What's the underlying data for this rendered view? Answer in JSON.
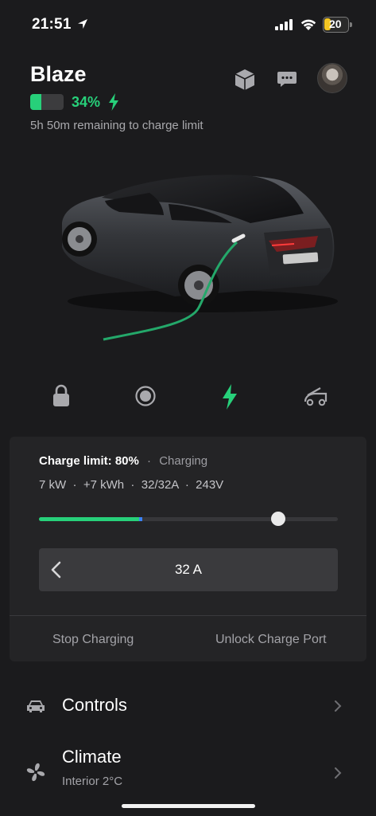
{
  "status_bar": {
    "time": "21:51",
    "battery_level": "20",
    "battery_color": "#f3c623"
  },
  "header": {
    "car_name": "Blaze",
    "battery_percent": "34%",
    "battery_fraction": 0.34,
    "remaining": "5h 50m remaining to charge limit",
    "accent": "#27d07a"
  },
  "quick_controls": [
    "lock-icon",
    "sentry-icon",
    "charge-bolt-icon",
    "frunk-icon"
  ],
  "charge_card": {
    "limit_label": "Charge limit: 80%",
    "separator": "·",
    "state": "Charging",
    "stats": "7 kW  ·  +7 kWh  ·  32/32A  ·  243V",
    "current_charge_fraction": 0.34,
    "limit_fraction": 0.8,
    "amps": "32 A",
    "stop_label": "Stop Charging",
    "unlock_label": "Unlock Charge Port"
  },
  "rows": [
    {
      "title": "Controls",
      "icon": "car-icon"
    },
    {
      "title": "Climate",
      "subtitle": "Interior 2°C",
      "icon": "fan-icon"
    }
  ]
}
